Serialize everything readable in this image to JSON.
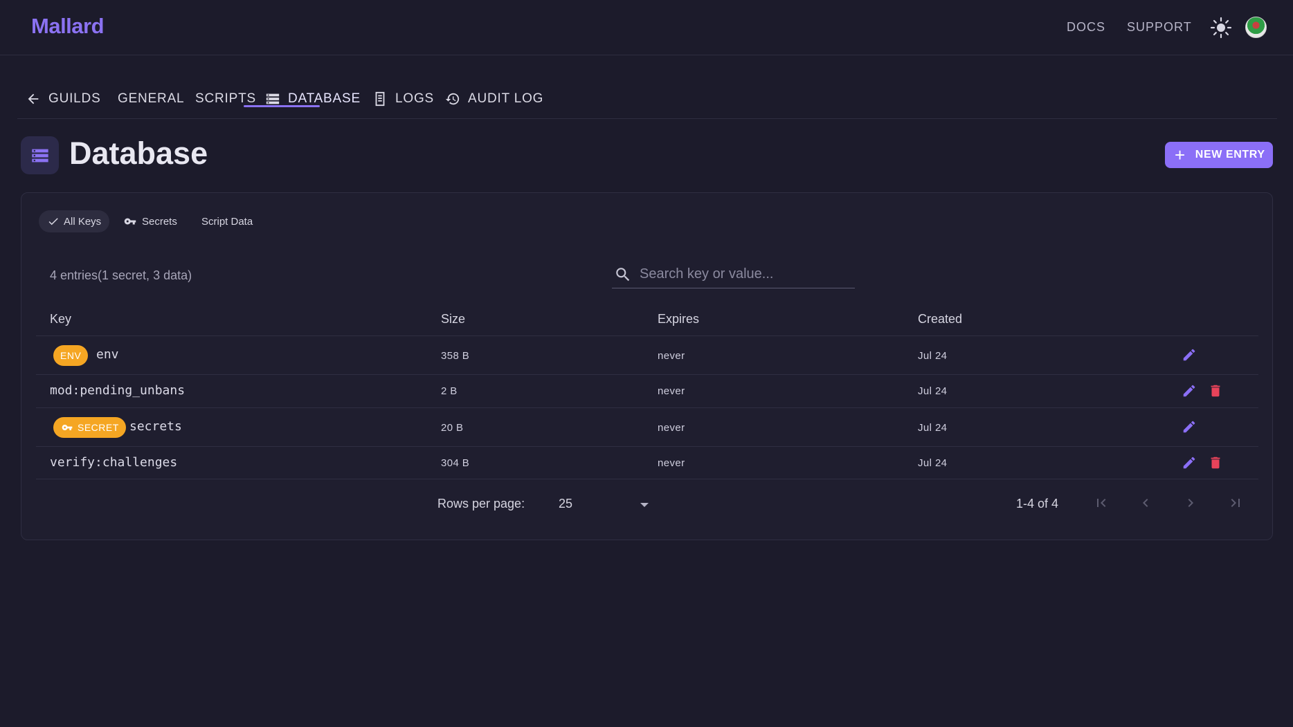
{
  "app": {
    "name": "Mallard",
    "brand_color": "#8b72f2"
  },
  "topnav": {
    "docs": "DOCS",
    "support": "SUPPORT",
    "theme_icon": "sun-icon",
    "avatar": "user-avatar"
  },
  "tabs": [
    {
      "label": "GUILDS",
      "icon": "arrow-left-icon"
    },
    {
      "label": "GENERAL"
    },
    {
      "label": "SCRIPTS"
    },
    {
      "label": "DATABASE",
      "icon": "database-icon",
      "active": true
    },
    {
      "label": "LOGS",
      "icon": "logs-icon"
    },
    {
      "label": "AUDIT LOG",
      "icon": "history-icon"
    }
  ],
  "page": {
    "title": "Database",
    "icon": "database-icon",
    "new_entry_label": "NEW ENTRY"
  },
  "filters": [
    {
      "label": "All Keys",
      "icon": "check-icon",
      "selected": true
    },
    {
      "label": "Secrets",
      "icon": "key-icon",
      "selected": false
    },
    {
      "label": "Script Data",
      "selected": false
    }
  ],
  "summary": "4 entries(1 secret, 3 data)",
  "search": {
    "placeholder": "Search key or value...",
    "value": ""
  },
  "table": {
    "columns": [
      "Key",
      "Size",
      "Expires",
      "Created"
    ],
    "rows": [
      {
        "badge": "ENV",
        "key": "env",
        "size": "358 B",
        "expires": "never",
        "created": "Jul 24",
        "deletable": false
      },
      {
        "badge": "",
        "key": "mod:pending_unbans",
        "size": "2 B",
        "expires": "never",
        "created": "Jul 24",
        "deletable": true
      },
      {
        "badge": "SECRET",
        "key": "secrets",
        "size": "20 B",
        "expires": "never",
        "created": "Jul 24",
        "deletable": false
      },
      {
        "badge": "",
        "key": "verify:challenges",
        "size": "304 B",
        "expires": "never",
        "created": "Jul 24",
        "deletable": true
      }
    ],
    "badge_color": "#f5a623",
    "edit_color": "#8b6ff7",
    "delete_color": "#e8435a"
  },
  "pagination": {
    "rows_per_page_label": "Rows per page:",
    "rows_per_page": "25",
    "range": "1-4 of 4"
  }
}
